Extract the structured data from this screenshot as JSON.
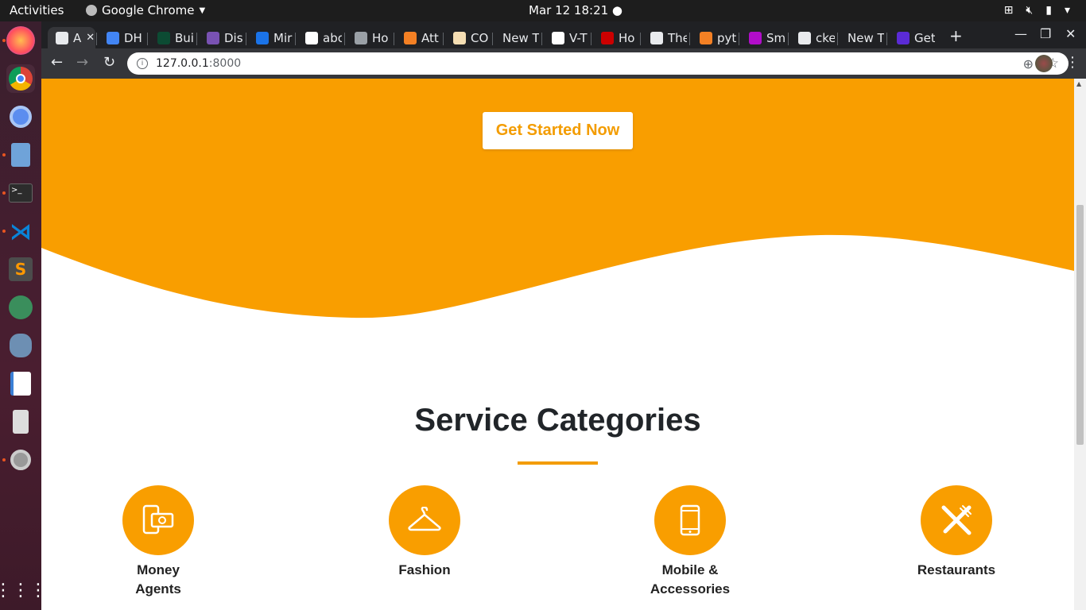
{
  "desktop": {
    "activities": "Activities",
    "app_name": "Google Chrome",
    "clock": "Mar 12  18:21"
  },
  "tabs": [
    {
      "label": "A",
      "color": "#e8eaed"
    },
    {
      "label": "DH",
      "color": "#4285f4"
    },
    {
      "label": "Bui",
      "color": "#0c4b33"
    },
    {
      "label": "Dis",
      "color": "#7952b3"
    },
    {
      "label": "Mir",
      "color": "#1a73e8"
    },
    {
      "label": "abc",
      "color": "#ffffff"
    },
    {
      "label": "Ho",
      "color": "#9aa0a6"
    },
    {
      "label": "Att",
      "color": "#f48024"
    },
    {
      "label": "CO",
      "color": "#f5deb3"
    },
    {
      "label": "New T",
      "color": "#202124"
    },
    {
      "label": "V-T",
      "color": "#ffffff"
    },
    {
      "label": "Ho",
      "color": "#cc0000"
    },
    {
      "label": "The",
      "color": "#e8eaed"
    },
    {
      "label": "pyt",
      "color": "#f48024"
    },
    {
      "label": "Sm",
      "color": "#b10dc9"
    },
    {
      "label": "cke",
      "color": "#e8eaed"
    },
    {
      "label": "New T",
      "color": "#202124"
    },
    {
      "label": "Get",
      "color": "#5b2bd6"
    }
  ],
  "address_bar": {
    "host": "127.0.0.1",
    "port": ":8000"
  },
  "page": {
    "cta_label": "Get Started Now",
    "section_title": "Service Categories",
    "accent_color": "#f99e00",
    "categories": [
      {
        "label_line1": "Money",
        "label_line2": "Agents",
        "icon": "money-icon"
      },
      {
        "label_line1": "Fashion",
        "label_line2": "",
        "icon": "hanger-icon"
      },
      {
        "label_line1": "Mobile &",
        "label_line2": "Accessories",
        "icon": "phone-icon"
      },
      {
        "label_line1": "Restaurants",
        "label_line2": "",
        "icon": "utensils-icon"
      }
    ]
  }
}
